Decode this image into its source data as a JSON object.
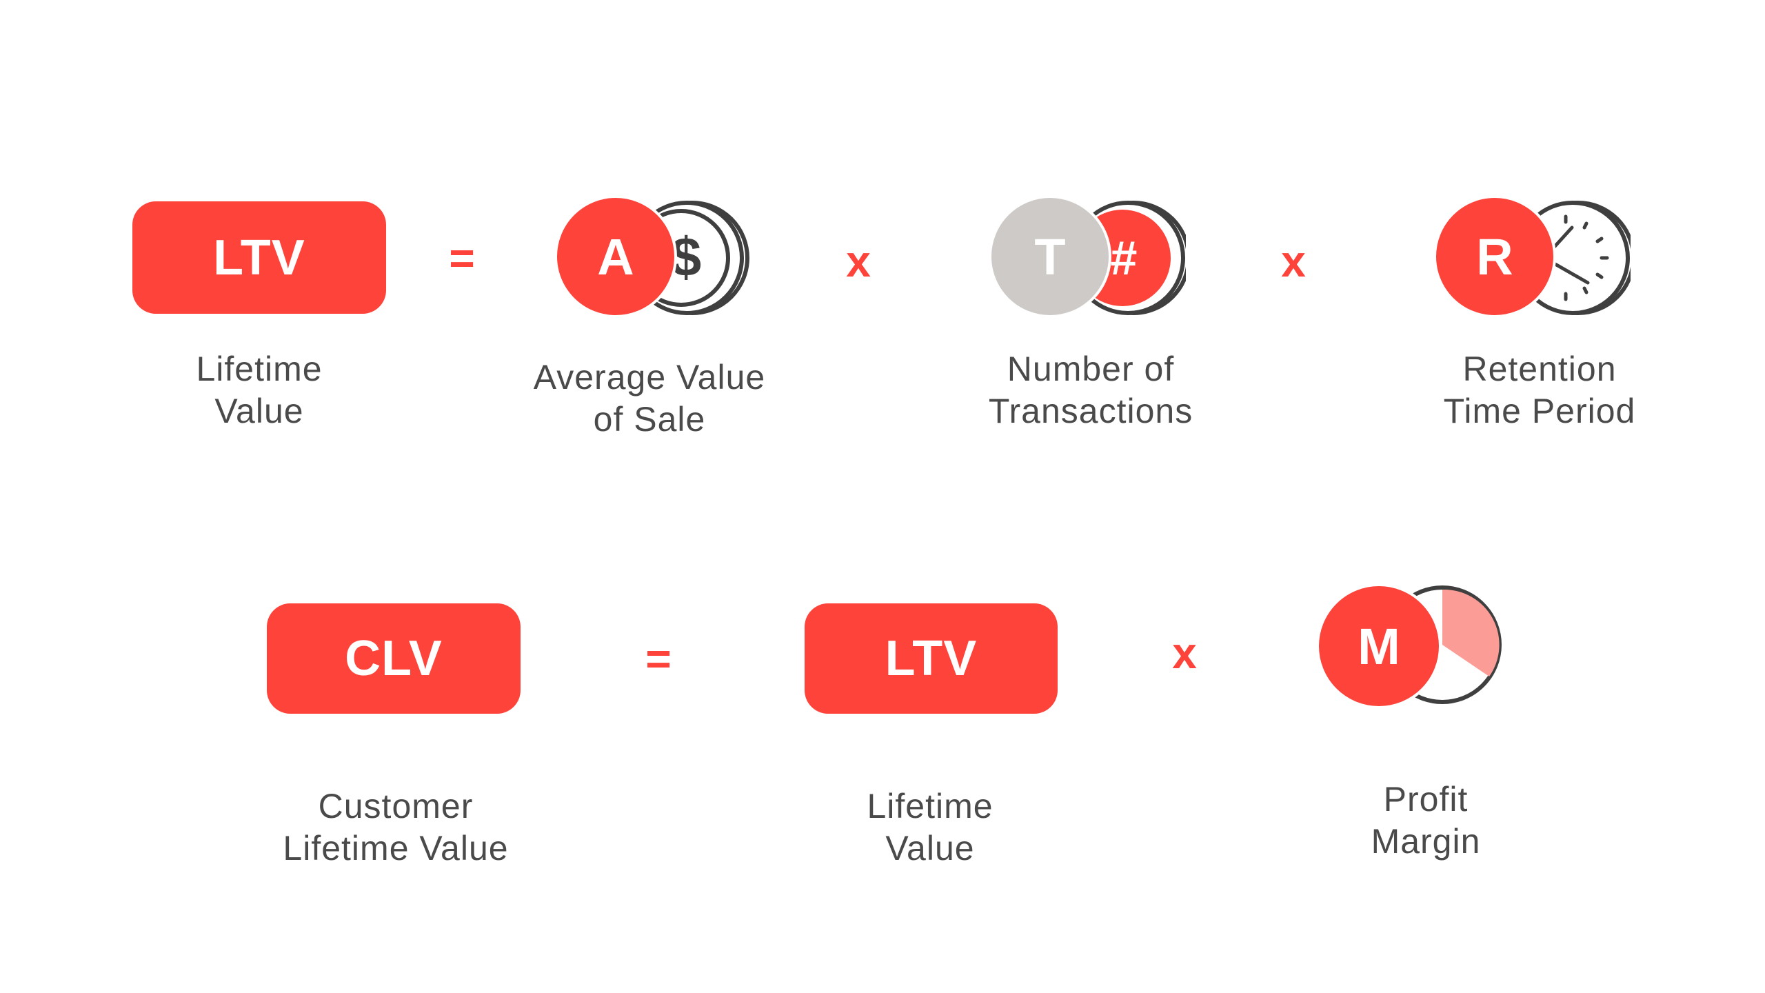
{
  "colors": {
    "accent": "#fd433a",
    "gray": "#cdcac7",
    "text": "#4a4a4a",
    "outline": "#3f3f3f",
    "pie_fill": "#fc9c97"
  },
  "formula1": {
    "result": {
      "abbr": "LTV",
      "label_lines": [
        "Lifetime",
        "Value"
      ]
    },
    "equals": "=",
    "terms": [
      {
        "letter": "A",
        "icon": "dollar-coin-icon",
        "glyph": "$",
        "label_lines": [
          "Average Value",
          "of Sale"
        ]
      },
      {
        "letter": "T",
        "icon": "hash-coin-icon",
        "glyph": "#",
        "label_lines": [
          "Number of",
          "Transactions"
        ]
      },
      {
        "letter": "R",
        "icon": "clock-icon",
        "label_lines": [
          "Retention",
          "Time Period"
        ]
      }
    ],
    "operator": "x"
  },
  "formula2": {
    "result": {
      "abbr": "CLV",
      "label_lines": [
        "Customer",
        "Lifetime Value"
      ]
    },
    "equals": "=",
    "term1": {
      "abbr": "LTV",
      "label_lines": [
        "Lifetime",
        "Value"
      ]
    },
    "operator": "x",
    "term2": {
      "letter": "M",
      "icon": "pie-chart-icon",
      "label_lines": [
        "Profit",
        "Margin"
      ]
    }
  }
}
